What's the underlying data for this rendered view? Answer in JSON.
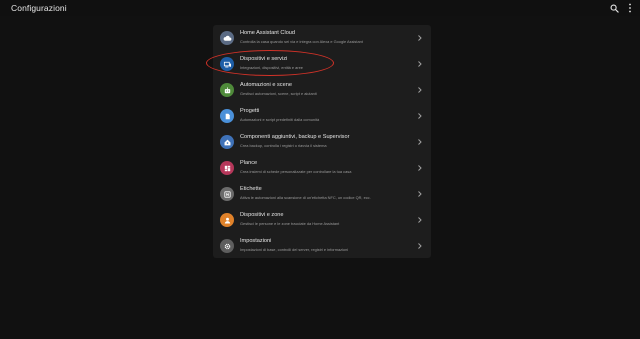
{
  "header": {
    "title": "Configurazioni",
    "search_icon": "search-icon",
    "menu_icon": "more-vertical-icon"
  },
  "items": [
    {
      "id": "cloud",
      "title": "Home Assistant Cloud",
      "subtitle": "Controlla la casa quando sei via e integra con Alexa e Google Assistant",
      "icon": "cloud-icon",
      "color": "#5b6b84"
    },
    {
      "id": "devices",
      "title": "Dispositivi e servizi",
      "subtitle": "Integrazioni, dispositivi, entità e aree",
      "icon": "devices-icon",
      "color": "#1e5fa8",
      "highlighted": true
    },
    {
      "id": "automations",
      "title": "Automazioni e scene",
      "subtitle": "Gestisci automazioni, scene, script e aiutanti",
      "icon": "robot-icon",
      "color": "#4f8a3a"
    },
    {
      "id": "blueprints",
      "title": "Progetti",
      "subtitle": "Automazioni e script predefiniti dalla comunità",
      "icon": "blueprint-icon",
      "color": "#4a90d9"
    },
    {
      "id": "addons",
      "title": "Componenti aggiuntivi, backup e Supervisor",
      "subtitle": "Crea backup, controlla i registri o riavvia il sistema",
      "icon": "home-assistant-icon",
      "color": "#3f72b8"
    },
    {
      "id": "dashboards",
      "title": "Plance",
      "subtitle": "Crea insiemi di schede personalizzate per controllare la tua casa",
      "icon": "dashboard-icon",
      "color": "#b5375a"
    },
    {
      "id": "tags",
      "title": "Etichette",
      "subtitle": "Attiva le automazioni alla scansione di un'etichetta NFC, un codice QR, ecc.",
      "icon": "nfc-icon",
      "color": "#6b6b6b"
    },
    {
      "id": "people",
      "title": "Dispositivi e zone",
      "subtitle": "Gestisci le persone e le zone tracciate da Home Assistant",
      "icon": "person-icon",
      "color": "#e0822a"
    },
    {
      "id": "settings",
      "title": "Impostazioni",
      "subtitle": "Impostazioni di base, controlli del server, registri e informazioni",
      "icon": "gear-icon",
      "color": "#5e5e5e"
    }
  ]
}
